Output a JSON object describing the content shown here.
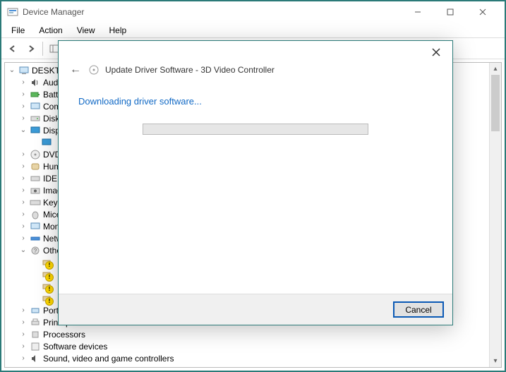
{
  "window": {
    "title": "Device Manager"
  },
  "menubar": {
    "file": "File",
    "action": "Action",
    "view": "View",
    "help": "Help"
  },
  "tree": {
    "root": "DESKTOP",
    "nodes": {
      "audio": "Audio inputs and outputs",
      "batteries": "Batteries",
      "computer": "Computer",
      "disk": "Disk drives",
      "display": "Display adapters",
      "dvd": "DVD/CD-ROM drives",
      "hid": "Human Interface Devices",
      "ide": "IDE ATA/ATAPI controllers",
      "imaging": "Imaging devices",
      "keyboards": "Keyboards",
      "mice": "Mice and other pointing devices",
      "monitors": "Monitors",
      "network": "Network adapters",
      "other": "Other devices",
      "ports": "Ports (COM & LPT)",
      "printq": "Print queues",
      "processors": "Processors",
      "software": "Software devices",
      "sound": "Sound, video and game controllers"
    }
  },
  "dialog": {
    "title": "Update Driver Software - 3D Video Controller",
    "status": "Downloading driver software...",
    "cancel": "Cancel"
  }
}
